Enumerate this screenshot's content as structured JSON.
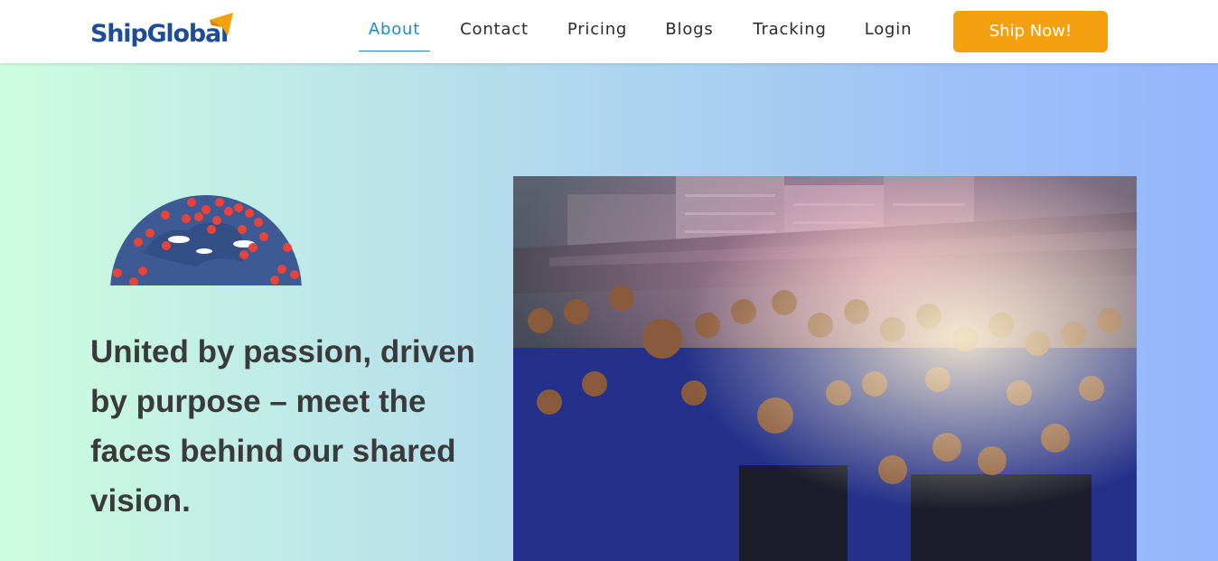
{
  "brand": {
    "name_part1": "Ship",
    "name_part2": "Global",
    "primary_color": "#1f4d95",
    "accent_color": "#f5a00e"
  },
  "nav": {
    "items": [
      {
        "label": "About",
        "active": true
      },
      {
        "label": "Contact",
        "active": false
      },
      {
        "label": "Pricing",
        "active": false
      },
      {
        "label": "Blogs",
        "active": false
      },
      {
        "label": "Tracking",
        "active": false
      },
      {
        "label": "Login",
        "active": false
      }
    ],
    "cta_label": "Ship Now!",
    "active_color": "#1a8ad1"
  },
  "hero": {
    "headline": "United by passion, driven by purpose – meet the faces behind our shared vision.",
    "globe_icon": "globe-with-location-pins-icon",
    "photo": "team-group-photo"
  }
}
